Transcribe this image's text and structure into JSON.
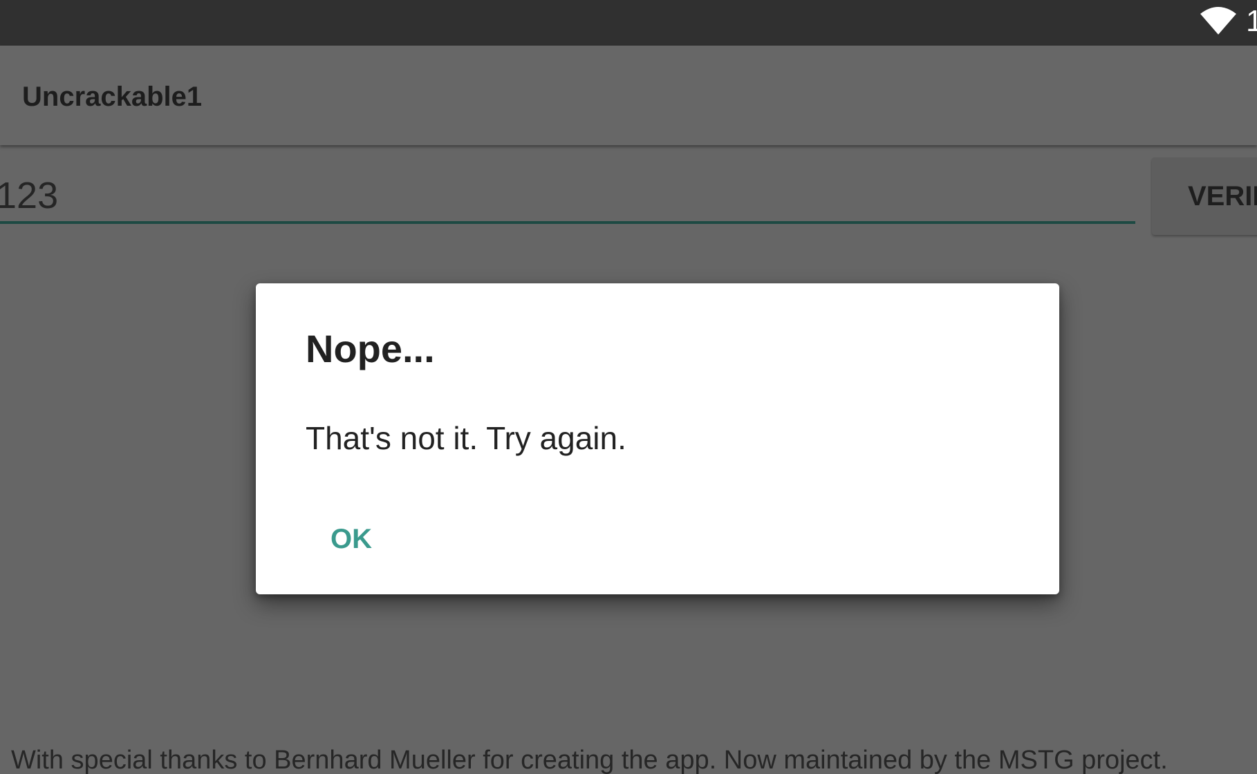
{
  "status_bar": {
    "wifi_icon": "wifi-icon",
    "clock_partial": "1"
  },
  "app_bar": {
    "title": "Uncrackable1"
  },
  "form": {
    "input_value": "123",
    "verify_label": "VERIFY"
  },
  "dialog": {
    "title": "Nope...",
    "message": "That's not it. Try again.",
    "ok_label": "OK"
  },
  "footer": {
    "text": "With special thanks to Bernhard Mueller for creating the app. Now maintained by the MSTG project."
  },
  "colors": {
    "status_bar": "#303030",
    "scrim_background": "#666666",
    "accent": "#3a9a8d",
    "input_underline": "#1d4a43",
    "dialog_background": "#ffffff"
  }
}
